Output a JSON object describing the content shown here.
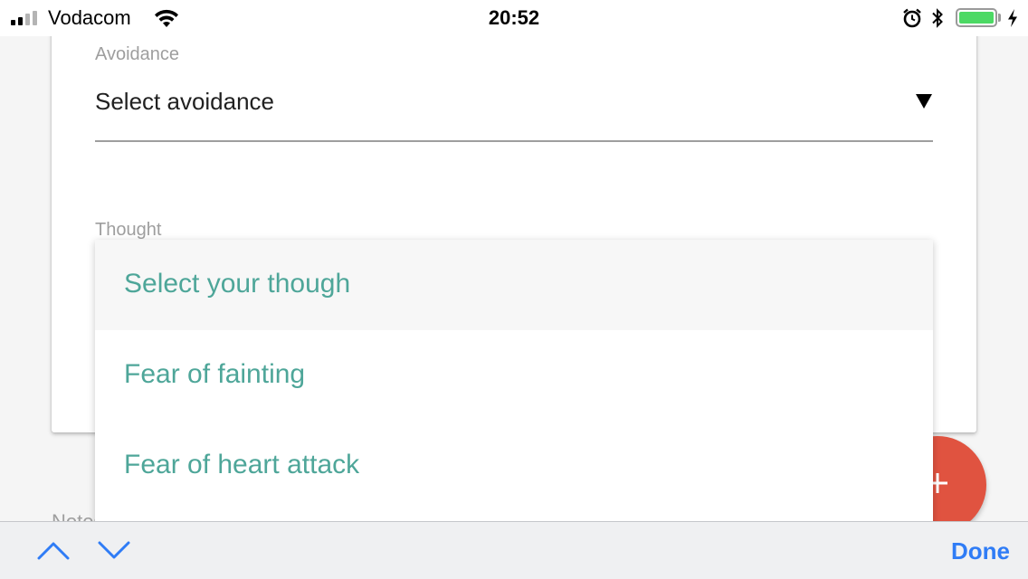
{
  "status_bar": {
    "carrier": "Vodacom",
    "time": "20:52",
    "signal_bars_filled": 2,
    "signal_bars_total": 4,
    "icons": [
      "signal-icon",
      "wifi-icon",
      "alarm-icon",
      "bluetooth-icon",
      "battery-icon",
      "charging-icon"
    ],
    "battery_level": 1.0,
    "battery_color": "#4cd964"
  },
  "form": {
    "avoidance": {
      "label": "Avoidance",
      "value": "Select avoidance",
      "icon": "dropdown-arrow-icon"
    },
    "thought": {
      "label": "Thought",
      "dropdown_open": true,
      "options": [
        {
          "label": "Select your though",
          "highlighted": true
        },
        {
          "label": "Fear of fainting",
          "highlighted": false
        },
        {
          "label": "Fear of heart attack",
          "highlighted": false
        }
      ]
    },
    "notes": {
      "label": "Notes"
    }
  },
  "fab": {
    "icon": "plus-icon",
    "color": "#e05340"
  },
  "keyboard_accessory": {
    "prev_icon": "chevron-up-icon",
    "next_icon": "chevron-down-icon",
    "done_label": "Done"
  },
  "colors": {
    "option_text": "#4ea699",
    "option_highlight_bg": "#f7f7f7",
    "ios_blue": "#2f7cf6"
  }
}
